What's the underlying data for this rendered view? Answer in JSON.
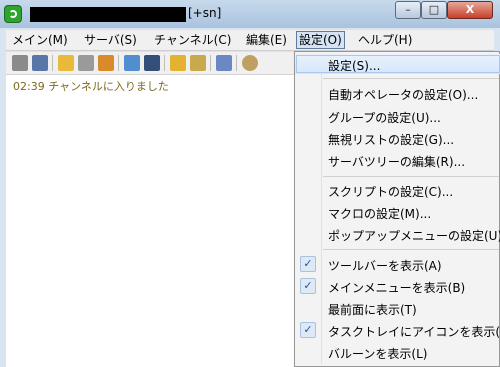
{
  "window": {
    "title_suffix": "[+sn]",
    "close_glyph": "X",
    "min_glyph": "–",
    "max_glyph": "□"
  },
  "menubar": [
    {
      "label": "メイン(M)"
    },
    {
      "label": "サーバ(S)"
    },
    {
      "label": "チャンネル(C)"
    },
    {
      "label": "編集(E)"
    },
    {
      "label": "設定(O)"
    },
    {
      "label": "ヘルプ(H)"
    }
  ],
  "log": {
    "line": "02:39 チャンネルに入りました"
  },
  "settings_menu": {
    "items": [
      {
        "label": "設定(S)..."
      },
      {
        "label": "自動オペレータの設定(O)..."
      },
      {
        "label": "グループの設定(U)..."
      },
      {
        "label": "無視リストの設定(G)..."
      },
      {
        "label": "サーバツリーの編集(R)..."
      },
      {
        "label": "スクリプトの設定(C)..."
      },
      {
        "label": "マクロの設定(M)..."
      },
      {
        "label": "ポップアップメニューの設定(U)"
      },
      {
        "label": "ツールバーを表示(A)",
        "checked": true
      },
      {
        "label": "メインメニューを表示(B)",
        "checked": true
      },
      {
        "label": "最前面に表示(T)",
        "checked": false
      },
      {
        "label": "タスクトレイにアイコンを表示(",
        "checked": true
      },
      {
        "label": "バルーンを表示(L)",
        "checked": false
      }
    ]
  },
  "colors": {
    "accent": "#1d55a6",
    "log_text": "#7a6a1e",
    "highlight": "#d6e6fa"
  }
}
